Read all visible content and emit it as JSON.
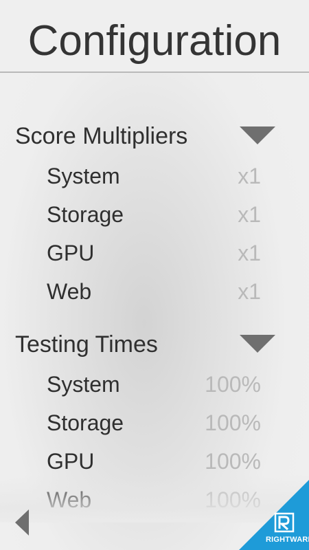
{
  "header": {
    "title": "Configuration"
  },
  "sections": [
    {
      "title": "Score Multipliers",
      "toggle_icon": "triangle-down-icon",
      "rows": [
        {
          "label": "System",
          "value": "x1"
        },
        {
          "label": "Storage",
          "value": "x1"
        },
        {
          "label": "GPU",
          "value": "x1"
        },
        {
          "label": "Web",
          "value": "x1"
        }
      ]
    },
    {
      "title": "Testing Times",
      "toggle_icon": "triangle-down-icon",
      "rows": [
        {
          "label": "System",
          "value": "100%"
        },
        {
          "label": "Storage",
          "value": "100%"
        },
        {
          "label": "GPU",
          "value": "100%"
        },
        {
          "label": "Web",
          "value": "100%"
        }
      ]
    }
  ],
  "footer": {
    "back_icon": "triangle-left-icon",
    "logo_text": "RIGHTWARE"
  },
  "colors": {
    "accent": "#1e9bd8",
    "text": "#2f2f2f",
    "value_text": "#b9b9b9",
    "icon": "#6f6f6f"
  }
}
